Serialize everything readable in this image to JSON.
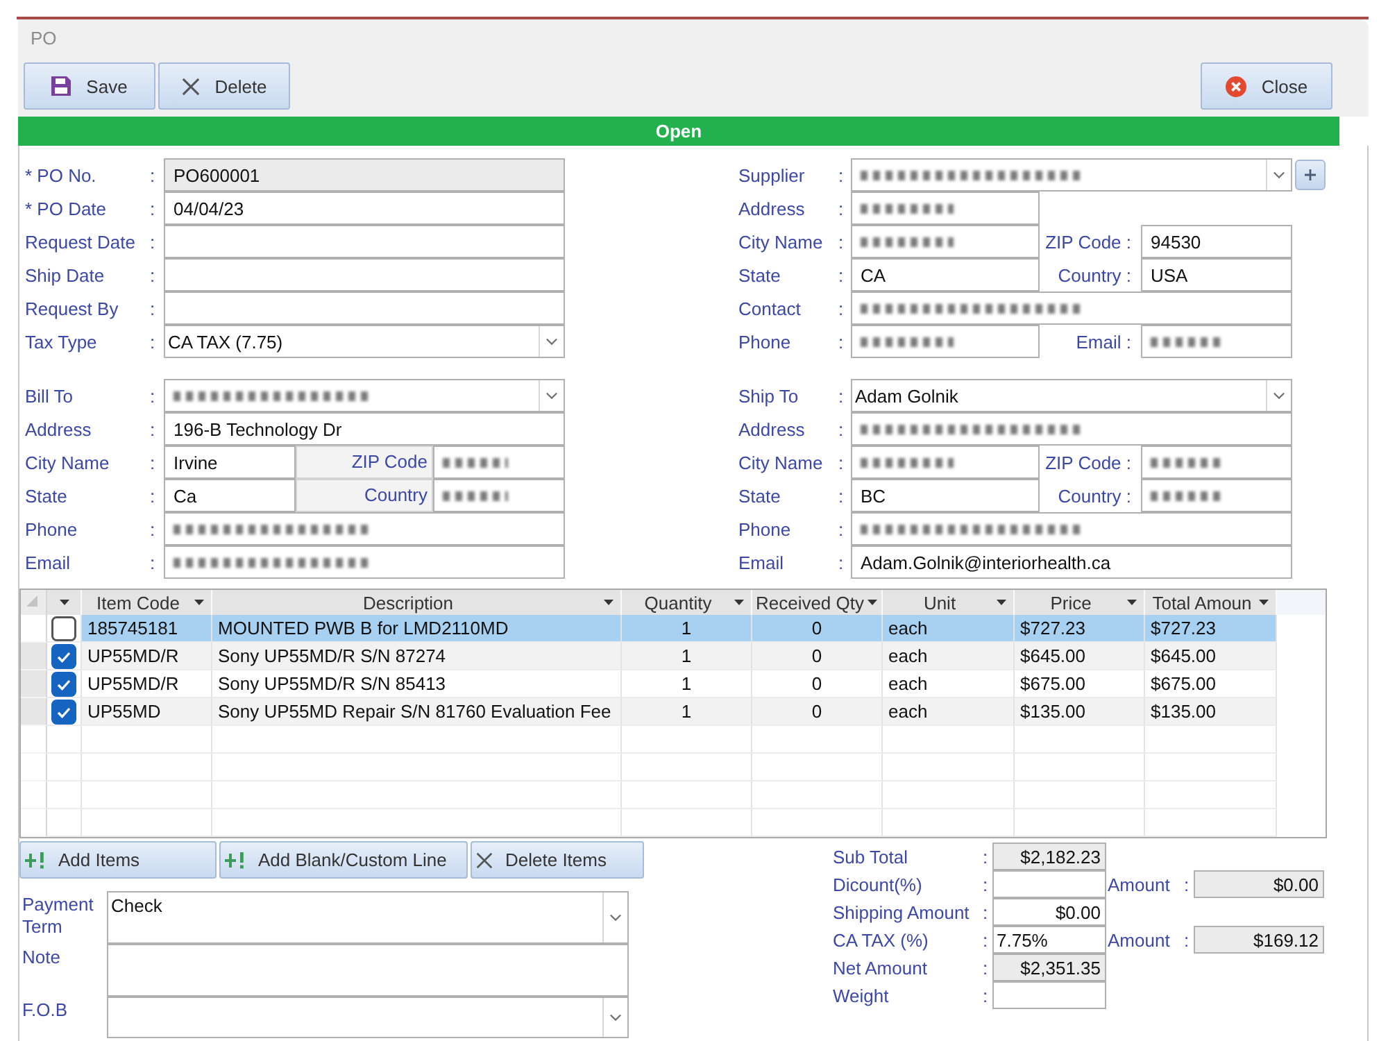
{
  "window": {
    "title": "PO"
  },
  "toolbar": [
    {
      "label": "Save",
      "kind": "save"
    },
    {
      "label": "Delete",
      "kind": "delete"
    },
    {
      "label": "Close",
      "kind": "close"
    }
  ],
  "status": {
    "label": "Open"
  },
  "po": [
    {
      "label": "* PO No.",
      "sep": ":",
      "field": {
        "kind": "text",
        "value": "PO600001",
        "readonly": true,
        "redacted": false
      }
    },
    {
      "label": "* PO Date",
      "sep": ":",
      "field": {
        "kind": "text",
        "value": "04/04/23",
        "readonly": false,
        "redacted": false
      }
    },
    {
      "label": "Request Date",
      "sep": ":",
      "field": {
        "kind": "text",
        "readonly": false,
        "redacted": false
      }
    },
    {
      "label": "Ship Date",
      "sep": ":",
      "field": {
        "kind": "text",
        "readonly": false,
        "redacted": false
      }
    },
    {
      "label": "Request By",
      "sep": ":",
      "field": {
        "kind": "text",
        "readonly": false,
        "redacted": false
      }
    },
    {
      "label": "Tax Type",
      "sep": ":",
      "field": {
        "kind": "combo",
        "value": "CA TAX (7.75)",
        "readonly": false,
        "redacted": false
      }
    }
  ],
  "supplier": [
    {
      "label": "Supplier",
      "sep": ":",
      "field": {
        "kind": "combo",
        "readonly": false,
        "redacted": true
      },
      "add_button": true
    },
    {
      "label": "Address",
      "sep": ":",
      "field": {
        "kind": "short",
        "readonly": false,
        "redacted": true
      }
    },
    {
      "label": "City Name",
      "sep": ":",
      "field": {
        "kind": "short",
        "readonly": false,
        "redacted": true
      },
      "side": {
        "label": "ZIP Code :",
        "field": {
          "kind": "text",
          "value": "94530",
          "readonly": false,
          "redacted": false
        }
      }
    },
    {
      "label": "State",
      "sep": ":",
      "field": {
        "kind": "short",
        "value": "CA",
        "readonly": false,
        "redacted": false
      },
      "side": {
        "label": "Country :",
        "field": {
          "kind": "text",
          "value": "USA",
          "readonly": false,
          "redacted": false
        }
      }
    },
    {
      "label": "Contact",
      "sep": ":",
      "field": {
        "kind": "text",
        "readonly": false,
        "redacted": true
      }
    },
    {
      "label": "Phone",
      "sep": ":",
      "field": {
        "kind": "short",
        "readonly": false,
        "redacted": true
      },
      "side": {
        "label": "Email :",
        "field": {
          "kind": "text",
          "readonly": false,
          "redacted": true
        }
      }
    }
  ],
  "bill_to": [
    {
      "label": "Bill To",
      "sep": ":",
      "field": {
        "kind": "combo",
        "readonly": false,
        "redacted": true
      }
    },
    {
      "label": "Address",
      "sep": ":",
      "field": {
        "kind": "text",
        "value": "196-B Technology Dr",
        "readonly": false,
        "redacted": false
      }
    },
    {
      "label": "City Name",
      "sep": ":",
      "field": {
        "kind": "short",
        "value": "Irvine",
        "readonly": false,
        "redacted": false
      },
      "side": {
        "label": "ZIP Code",
        "field": {
          "kind": "text",
          "readonly": false,
          "redacted": true
        }
      }
    },
    {
      "label": "State",
      "sep": ":",
      "field": {
        "kind": "short",
        "value": "Ca",
        "readonly": false,
        "redacted": false
      },
      "side": {
        "label": "Country",
        "field": {
          "kind": "text",
          "readonly": false,
          "redacted": true
        }
      }
    },
    {
      "label": "Phone",
      "sep": ":",
      "field": {
        "kind": "text",
        "readonly": false,
        "redacted": true
      }
    },
    {
      "label": "Email",
      "sep": ":",
      "field": {
        "kind": "text",
        "readonly": false,
        "redacted": true
      }
    }
  ],
  "ship_to": [
    {
      "label": "Ship To",
      "sep": ":",
      "field": {
        "kind": "combo",
        "value": "Adam Golnik",
        "readonly": false,
        "redacted": false
      }
    },
    {
      "label": "Address",
      "sep": ":",
      "field": {
        "kind": "text",
        "readonly": false,
        "redacted": true
      }
    },
    {
      "label": "City Name",
      "sep": ":",
      "field": {
        "kind": "short",
        "readonly": false,
        "redacted": true
      },
      "side": {
        "label": "ZIP Code :",
        "field": {
          "kind": "text",
          "readonly": false,
          "redacted": true
        }
      }
    },
    {
      "label": "State",
      "sep": ":",
      "field": {
        "kind": "short",
        "value": "BC",
        "readonly": false,
        "redacted": false
      },
      "side": {
        "label": "Country :",
        "field": {
          "kind": "text",
          "readonly": false,
          "redacted": true
        }
      }
    },
    {
      "label": "Phone",
      "sep": ":",
      "field": {
        "kind": "text",
        "readonly": false,
        "redacted": true
      }
    },
    {
      "label": "Email",
      "sep": ":",
      "field": {
        "kind": "text",
        "value": "Adam.Golnik@interiorhealth.ca",
        "readonly": false,
        "redacted": false
      }
    }
  ],
  "items": {
    "columns": [
      {
        "label": "Item Code"
      },
      {
        "label": "Description"
      },
      {
        "label": "Quantity"
      },
      {
        "label": "Received Qty"
      },
      {
        "label": "Unit"
      },
      {
        "label": "Price"
      },
      {
        "label": "Total Amoun"
      }
    ],
    "rows": [
      {
        "selected": true,
        "checked": false,
        "cells": [
          "185745181",
          "MOUNTED PWB B for LMD2110MD",
          "1",
          "0",
          "each",
          "$727.23",
          "$727.23"
        ]
      },
      {
        "selected": false,
        "checked": true,
        "cells": [
          "UP55MD/R",
          "Sony UP55MD/R S/N 87274",
          "1",
          "0",
          "each",
          "$645.00",
          "$645.00"
        ]
      },
      {
        "selected": false,
        "checked": true,
        "cells": [
          "UP55MD/R",
          "Sony UP55MD/R S/N 85413",
          "1",
          "0",
          "each",
          "$675.00",
          "$675.00"
        ]
      },
      {
        "selected": false,
        "checked": true,
        "cells": [
          "UP55MD",
          "Sony UP55MD Repair S/N 81760 Evaluation Fee",
          "1",
          "0",
          "each",
          "$135.00",
          "$135.00"
        ]
      }
    ]
  },
  "line_buttons": [
    {
      "label": "Add Items",
      "kind": "add"
    },
    {
      "label": "Add Blank/Custom Line",
      "kind": "add"
    },
    {
      "label": "Delete Items",
      "kind": "delete"
    }
  ],
  "terms": [
    {
      "label": "Payment Term",
      "field": {
        "kind": "combo",
        "value": "Check",
        "readonly": false
      }
    },
    {
      "label": "Note",
      "field": {
        "kind": "memo",
        "readonly": false
      }
    },
    {
      "label": "F.O.B",
      "field": {
        "kind": "combo",
        "readonly": false
      }
    }
  ],
  "totals": [
    {
      "label": "Sub Total",
      "sep": ":",
      "field": {
        "kind": "currency",
        "value": "$2,182.23",
        "readonly": true
      }
    },
    {
      "label": "Dicount(%)",
      "sep": ":",
      "field": {
        "kind": "percent",
        "readonly": false
      },
      "amount": {
        "label": "Amount",
        "sep": ":",
        "field": {
          "kind": "currency",
          "value": "$0.00",
          "readonly": true
        }
      }
    },
    {
      "label": "Shipping Amount",
      "sep": ":",
      "field": {
        "kind": "currency",
        "value": "$0.00",
        "readonly": false
      }
    },
    {
      "label": "CA TAX (%)",
      "sep": ":",
      "field": {
        "kind": "percent",
        "value": "7.75%",
        "readonly": false
      },
      "amount": {
        "label": "Amount",
        "sep": ":",
        "field": {
          "kind": "currency",
          "value": "$169.12",
          "readonly": true
        }
      }
    },
    {
      "label": "Net Amount",
      "sep": ":",
      "field": {
        "kind": "currency",
        "value": "$2,351.35",
        "readonly": true
      }
    },
    {
      "label": "Weight",
      "sep": ":",
      "field": {
        "kind": "number",
        "readonly": false
      }
    }
  ]
}
